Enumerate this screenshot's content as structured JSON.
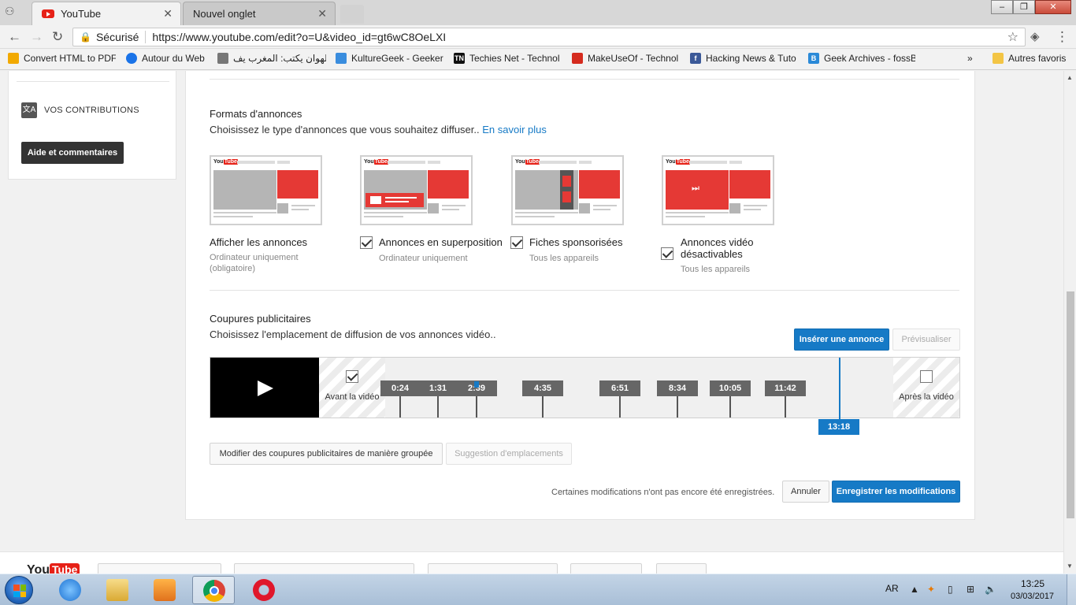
{
  "browser": {
    "tabs": [
      {
        "label": "YouTube",
        "active": true
      },
      {
        "label": "Nouvel onglet",
        "active": false
      }
    ],
    "close_glyph": "✕",
    "secure_label": "Sécurisé",
    "url": "https://www.youtube.com/edit?o=U&video_id=gt6wC8OeLXI",
    "bookmarks": [
      {
        "label": "Convert HTML to PDF",
        "color": "#f2a900"
      },
      {
        "label": "Autour du Web",
        "color": "#1a73e8"
      },
      {
        "label": "عمر الهوان يكتب: المغرب يف",
        "color": "#777777"
      },
      {
        "label": "KultureGeek - Geeker",
        "color": "#3a8dde"
      },
      {
        "label": "Techies Net - Technol",
        "color": "#111111"
      },
      {
        "label": "MakeUseOf - Technol",
        "color": "#d52b1e"
      },
      {
        "label": "Hacking News & Tuto",
        "color": "#3b5998"
      },
      {
        "label": "Geek Archives - fossB",
        "color": "#2b8ad8"
      }
    ],
    "other_bookmarks": "Autres favoris",
    "window_buttons": [
      "–",
      "❐",
      "✕"
    ]
  },
  "sidebar": {
    "contributions_label": "VOS CONTRIBUTIONS",
    "help_button": "Aide et commentaires"
  },
  "formats": {
    "title": "Formats d'annonces",
    "description": "Choisissez le type d'annonces que vous souhaitez diffuser..",
    "learn_more": "En savoir plus",
    "logo_text": "You",
    "logo_tube": "Tube",
    "items": [
      {
        "label": "Afficher les annonces",
        "sub": "Ordinateur uniquement (obligatoire)",
        "checked": false,
        "has_checkbox": false
      },
      {
        "label": "Annonces en superposition",
        "sub": "Ordinateur uniquement",
        "checked": true,
        "has_checkbox": true
      },
      {
        "label": "Fiches sponsorisées",
        "sub": "Tous les appareils",
        "checked": true,
        "has_checkbox": true
      },
      {
        "label": "Annonces vidéo désactivables",
        "sub": "Tous les appareils",
        "checked": true,
        "has_checkbox": true
      }
    ]
  },
  "breaks": {
    "title": "Coupures publicitaires",
    "description": "Choisissez l'emplacement de diffusion de vos annonces vidéo..",
    "insert_button": "Insérer une annonce",
    "preview_button": "Prévisualiser",
    "before_label": "Avant la vidéo",
    "after_label": "Après la vidéo",
    "before_checked": true,
    "after_checked": false,
    "markers": [
      "0:24",
      "1:31",
      "2:39",
      "4:35",
      "6:51",
      "8:34",
      "10:05",
      "11:42"
    ],
    "playhead": "13:18",
    "bulk_edit_button": "Modifier des coupures publicitaires de manière groupée",
    "suggest_button": "Suggestion d'emplacements"
  },
  "save_bar": {
    "unsaved_text": "Certaines modifications n'ont pas encore été enregistrées.",
    "cancel_button": "Annuler",
    "save_button": "Enregistrer les modifications"
  },
  "footer": {
    "logo_you": "You",
    "logo_tube": "Tube"
  },
  "taskbar": {
    "language": "AR",
    "time": "13:25",
    "date": "03/03/2017"
  },
  "colors": {
    "youtube_red": "#e62117",
    "accent_blue": "#167ac6"
  }
}
